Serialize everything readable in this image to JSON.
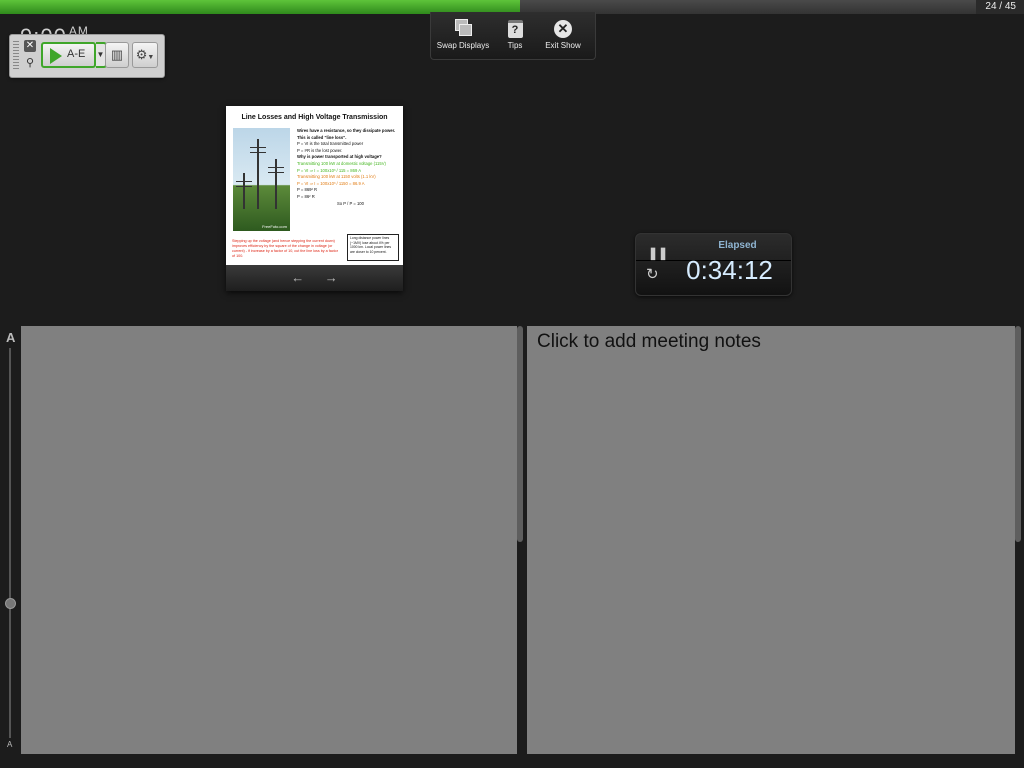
{
  "progress": {
    "current": 24,
    "total": 45,
    "fraction": 0.51,
    "counter_text": "24 / 45"
  },
  "clock": {
    "time": "9:00",
    "ampm": "AM"
  },
  "toolbar": {
    "play_label": "A-E"
  },
  "top_menu": {
    "items": [
      {
        "label": "Swap Displays",
        "icon": "swap-displays-icon"
      },
      {
        "label": "Tips",
        "icon": "tips-icon"
      },
      {
        "label": "Exit Show",
        "icon": "exit-icon"
      }
    ]
  },
  "slide": {
    "title": "Line Losses and High Voltage Transmission",
    "photo_credit": "FreeFoto.com",
    "lines": [
      "Wires have a resistance, so they dissipate power. This is called \"line loss\".",
      "P = VI  is the total transmitted power",
      "P = I²R  is the lost power.",
      "Why is power transported at high voltage?",
      "Transmitting 100 kW at domestic voltage (115V)",
      "P = VI  ⇒  I = 100x10³ / 115 = 869 A",
      "Transmitting 100 kW at 1150 volts (1.1 kV)",
      "P = VI  ⇒  I = 100x10³ / 1150 = 86.9 A",
      "P = 869² R",
      "P = 86² R",
      "So  P / P = 100"
    ],
    "red_note": "Stepping up the voltage (and hence stepping the current down) improves efficiency by the square of the change in voltage (or current) - if increase by a factor of 10, cut the line loss by a factor of 100.",
    "box_note": "Long distance power lines (~1MV) lose about 4% per 1000 km. Local power lines are closer to 10 percent."
  },
  "timer": {
    "label": "Elapsed",
    "value": "0:34:12"
  },
  "notes": {
    "placeholder": "Click to add meeting notes"
  },
  "font_slider": {
    "large_label": "A",
    "small_label": "A",
    "level": 0.64
  }
}
